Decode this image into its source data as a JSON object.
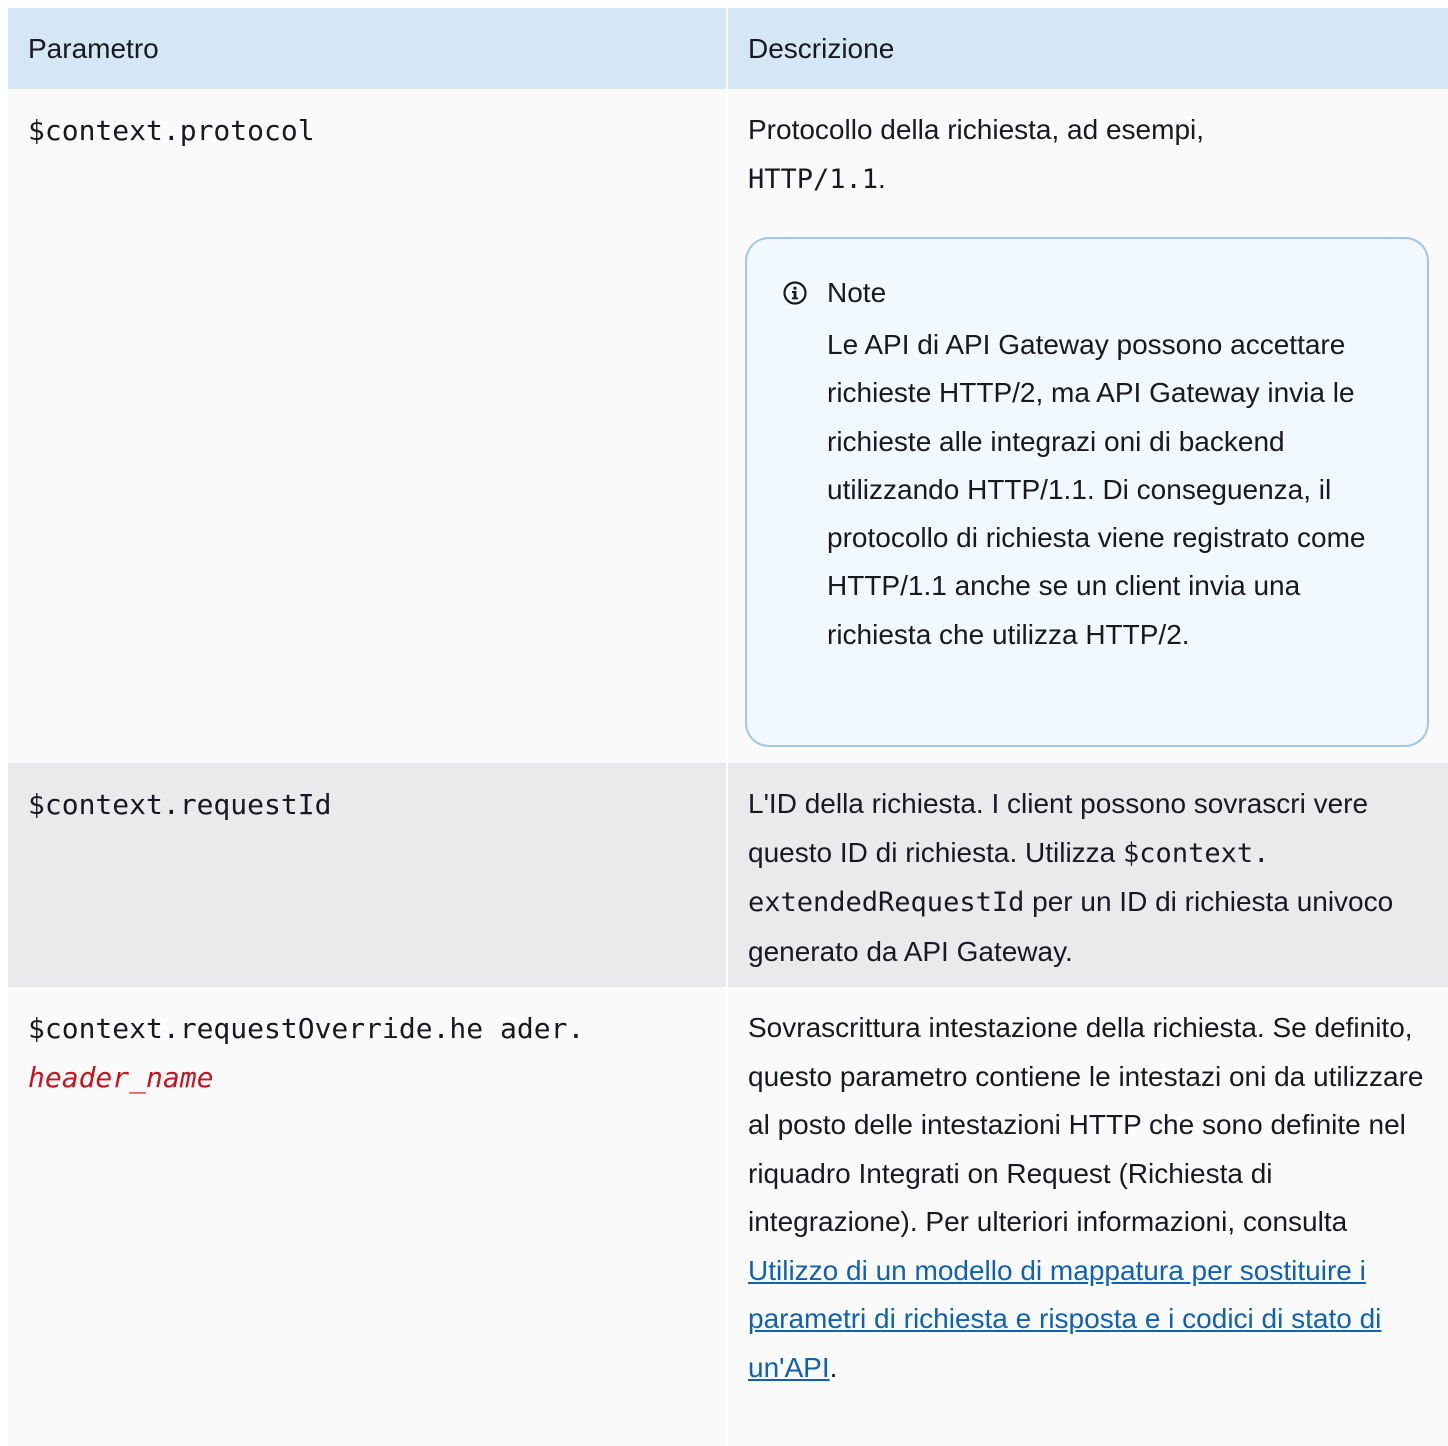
{
  "table": {
    "headers": [
      "Parametro",
      "Descrizione"
    ],
    "rows": [
      {
        "param": "$context.protocol",
        "desc_pre": "Protocollo della richiesta, ad esempi,",
        "desc_code": "HTTP/1.1",
        "desc_post": ".",
        "note": {
          "title": "Note",
          "icon": "info-icon",
          "text": "Le API di API Gateway possono accettare richieste HTTP/2, ma API Gateway invia le richieste alle integrazi oni di backend utilizzando HTTP/1.1. Di conseguenza, il protocollo di richiesta viene registrato come HTTP/1.1 anche se un client invia una richiesta che utilizza HTTP/2."
        }
      },
      {
        "param": "$context.requestId",
        "desc_pre": "L'ID della richiesta. I client possono sovrascri vere questo ID di richiesta. Utilizza",
        "desc_code": "$context. extendedRequestId",
        "desc_post": "per un ID di richiesta univoco generato da API Gateway."
      },
      {
        "param": "$context.requestOverride.he ader.",
        "param_placeholder": "header_name",
        "desc_pre": "Sovrascrittura intestazione della richiesta. Se definito, questo parametro contiene le intestazi oni da utilizzare al posto delle intestazioni HTTP che sono definite nel riquadro Integrati on Request (Richiesta di integrazione). Per ulteriori informazioni, consulta",
        "desc_link": "Utilizzo di un modello di mappatura per sostituire i parametri di richiesta e risposta e i codici di stato di un'API",
        "desc_post": "."
      }
    ]
  },
  "colors": {
    "header_bg": "#d5e6f5",
    "row_light": "#fafafa",
    "row_dark": "#eaeaec",
    "note_bg": "#f1f8fe",
    "note_border": "#a3c6e6",
    "link": "#0f62b3",
    "placeholder": "#c7141e"
  }
}
